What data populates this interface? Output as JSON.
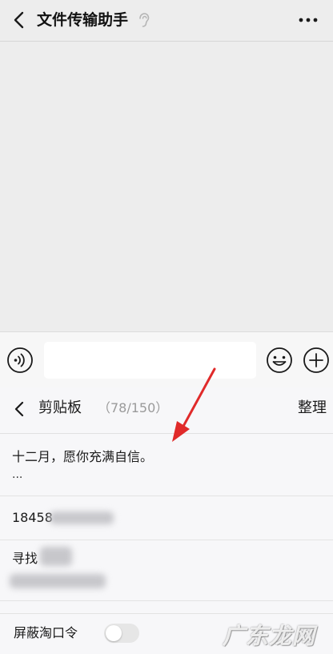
{
  "header": {
    "title": "文件传输助手",
    "back_icon": "back-chevron-icon",
    "ear_icon": "ear-icon",
    "more_icon": "more-dots-icon"
  },
  "input_bar": {
    "voice_icon": "voice-icon",
    "text_value": "",
    "emoji_icon": "emoji-icon",
    "plus_icon": "plus-icon"
  },
  "clipboard": {
    "title": "剪贴板",
    "count": "（78/150）",
    "organize_label": "整理",
    "items": [
      {
        "text": "十二月，愿你充满自信。",
        "more": "..."
      },
      {
        "text": "18458"
      },
      {
        "text": "寻找"
      }
    ],
    "footer": {
      "label": "屏蔽淘口令",
      "toggle_on": false
    }
  },
  "annotation": {
    "arrow_color": "#e02a2a"
  },
  "watermark": {
    "text": "广东龙网"
  },
  "colors": {
    "background": "#ededed",
    "input_bar": "#f7f7f7",
    "panel": "#f7f7f9",
    "muted_text": "#9a9a9a"
  }
}
